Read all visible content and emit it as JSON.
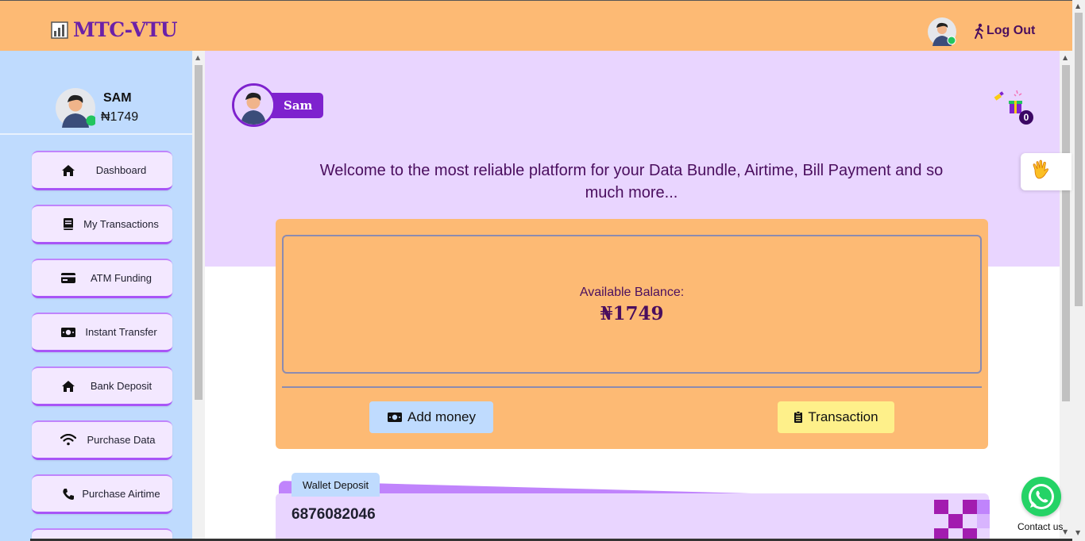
{
  "header": {
    "brand": "MTC-VTU",
    "logout_label": "Log Out"
  },
  "sidebar": {
    "user_name": "SAM",
    "user_balance": "₦1749",
    "items": [
      {
        "label": "Dashboard",
        "icon": "home-icon"
      },
      {
        "label": "My Transactions",
        "icon": "book-icon"
      },
      {
        "label": "ATM Funding",
        "icon": "credit-card-icon"
      },
      {
        "label": "Instant Transfer",
        "icon": "money-bill-icon"
      },
      {
        "label": "Bank Deposit",
        "icon": "home-icon"
      },
      {
        "label": "Purchase Data",
        "icon": "wifi-icon"
      },
      {
        "label": "Purchase Airtime",
        "icon": "phone-icon"
      }
    ]
  },
  "main": {
    "user_chip_name": "Sam",
    "gift_count": "0",
    "welcome_text": "Welcome to the most reliable platform for your Data Bundle, Airtime, Bill Payment and so much more...",
    "balance_label": "Available Balance:",
    "balance_value": "₦1749",
    "add_money_label": "Add money",
    "transaction_label": "Transaction",
    "deposit_tab_label": "Wallet Deposit",
    "account_number": "6876082046"
  },
  "widgets": {
    "contact_label": "Contact us"
  },
  "colors": {
    "header_bg": "#fdba74",
    "sidebar_bg": "#bfdbfe",
    "hero_bg": "#e9d5ff",
    "accent": "#7e22ce",
    "text_primary": "#4a0e5e",
    "whatsapp": "#25d366"
  }
}
